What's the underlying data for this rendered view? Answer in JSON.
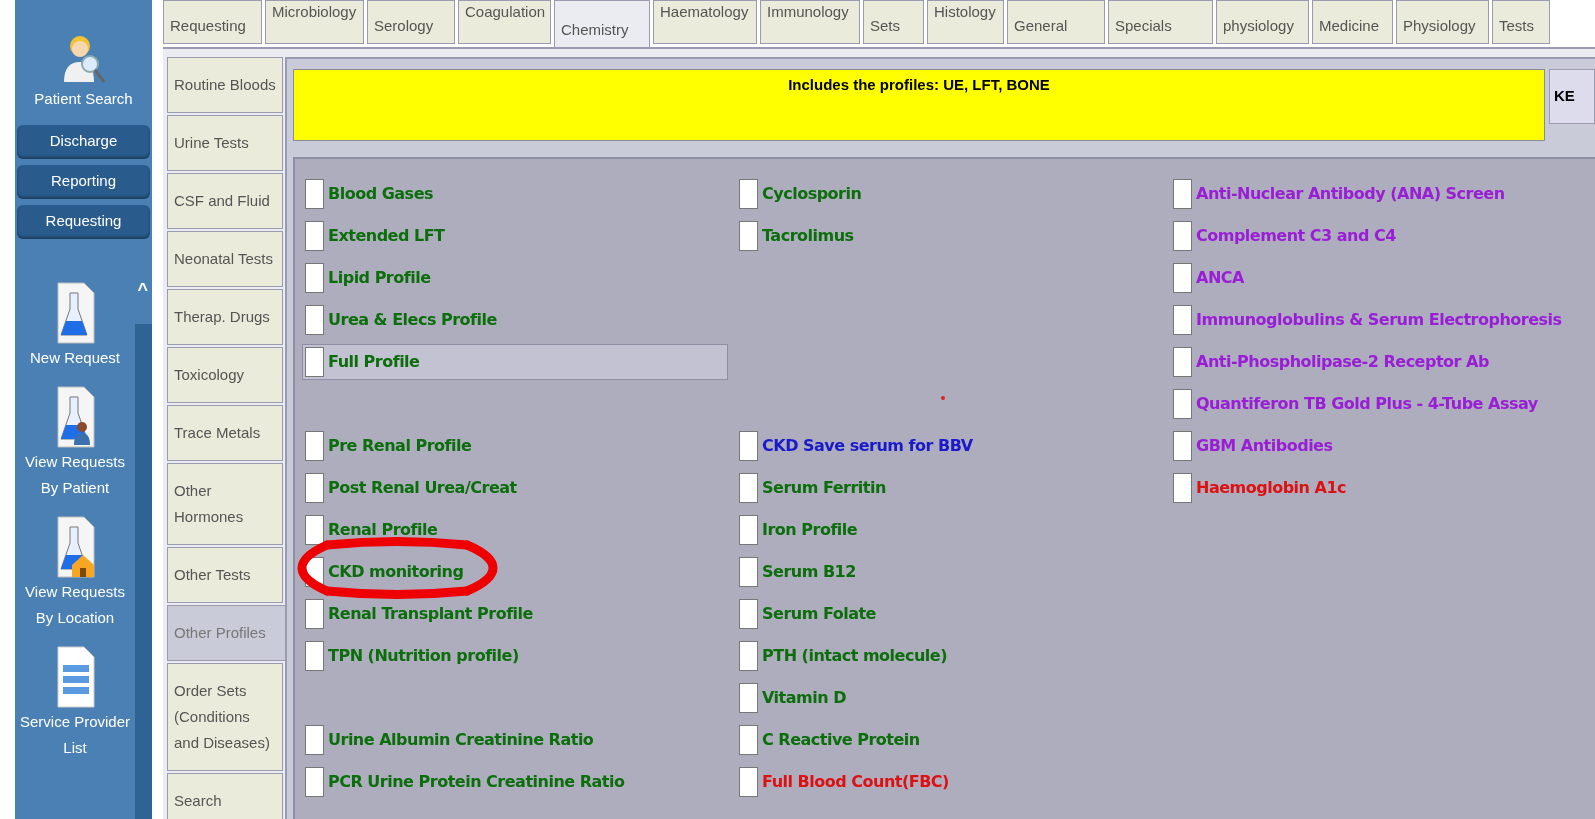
{
  "sidebar": {
    "patient_search": "Patient Search",
    "buttons": [
      "Discharge",
      "Reporting",
      "Requesting"
    ],
    "scroll_up": "^",
    "shortcuts": [
      {
        "kind": "flask",
        "label": "New Request"
      },
      {
        "kind": "flask_person",
        "label": "View Requests By Patient"
      },
      {
        "kind": "flask_house",
        "label": "View Requests By Location"
      },
      {
        "kind": "document",
        "label": "Service Provider List"
      }
    ]
  },
  "top_tabs": [
    {
      "label": "Requesting",
      "kind": "lower",
      "selected": false
    },
    {
      "label": "Microbiology",
      "kind": "upper",
      "selected": false
    },
    {
      "label": "Serology",
      "kind": "lower",
      "selected": false
    },
    {
      "label": "Coagulation",
      "kind": "upper",
      "selected": false
    },
    {
      "label": "Chemistry",
      "kind": "lower",
      "selected": true
    },
    {
      "label": "Haematology",
      "kind": "upper",
      "selected": false
    },
    {
      "label": "Immunology",
      "kind": "upper",
      "selected": false
    },
    {
      "label": "Sets",
      "kind": "lower",
      "selected": false
    },
    {
      "label": "Histology",
      "kind": "upper",
      "selected": false
    },
    {
      "label": "General",
      "kind": "lower",
      "selected": false
    },
    {
      "label": "Specials",
      "kind": "lower",
      "selected": false
    },
    {
      "label": "physiology",
      "kind": "lower",
      "selected": false
    },
    {
      "label": "Medicine",
      "kind": "lower",
      "selected": false
    },
    {
      "label": "Physiology",
      "kind": "lower",
      "selected": false
    },
    {
      "label": "Tests",
      "kind": "lower",
      "selected": false
    }
  ],
  "side_tabs": [
    {
      "label": "Routine Bloods",
      "selected": false
    },
    {
      "label": "Urine Tests",
      "selected": false
    },
    {
      "label": "CSF and Fluid",
      "selected": false
    },
    {
      "label": "Neonatal Tests",
      "selected": false
    },
    {
      "label": "Therap. Drugs",
      "selected": false
    },
    {
      "label": "Toxicology",
      "selected": false
    },
    {
      "label": "Trace Metals",
      "selected": false
    },
    {
      "label": "Other Hormones",
      "selected": false
    },
    {
      "label": "Other Tests",
      "selected": false
    },
    {
      "label": "Other Profiles",
      "selected": true
    },
    {
      "label": "Order Sets (Conditions and Diseases)",
      "selected": false
    },
    {
      "label": "Search",
      "selected": false
    }
  ],
  "banner": "Includes the profiles: UE, LFT, BONE",
  "banner_button": "KE",
  "test_rows": [
    [
      {
        "label": "Blood Gases",
        "color": "#0b6e0b",
        "checked": false,
        "focused": false
      },
      {
        "label": "Cyclosporin",
        "color": "#0b6e0b",
        "checked": false,
        "focused": false
      },
      {
        "label": "Anti-Nuclear Antibody (ANA) Screen",
        "color": "#9a1ed6",
        "checked": false,
        "focused": false
      }
    ],
    [
      {
        "label": "Extended LFT",
        "color": "#0b6e0b",
        "checked": false,
        "focused": false
      },
      {
        "label": "Tacrolimus",
        "color": "#0b6e0b",
        "checked": false,
        "focused": false
      },
      {
        "label": "Complement C3 and C4",
        "color": "#9a1ed6",
        "checked": false,
        "focused": false
      }
    ],
    [
      {
        "label": "Lipid Profile",
        "color": "#0b6e0b",
        "checked": false,
        "focused": false
      },
      null,
      {
        "label": "ANCA",
        "color": "#9a1ed6",
        "checked": false,
        "focused": false
      }
    ],
    [
      {
        "label": "Urea & Elecs Profile",
        "color": "#0b6e0b",
        "checked": false,
        "focused": false
      },
      null,
      {
        "label": "Immunoglobulins & Serum Electrophoresis",
        "color": "#9a1ed6",
        "checked": false,
        "focused": false
      }
    ],
    [
      {
        "label": "Full Profile",
        "color": "#0b6e0b",
        "checked": false,
        "focused": true
      },
      null,
      {
        "label": "Anti-Phospholipase-2 Receptor Ab",
        "color": "#9a1ed6",
        "checked": false,
        "focused": false
      }
    ],
    [
      null,
      null,
      {
        "label": "Quantiferon TB Gold Plus - 4-Tube Assay",
        "color": "#9a1ed6",
        "checked": false,
        "focused": false
      }
    ],
    [
      {
        "label": "Pre Renal Profile",
        "color": "#0b6e0b",
        "checked": false,
        "focused": false
      },
      {
        "label": "CKD Save serum for BBV",
        "color": "#1a1acc",
        "checked": false,
        "focused": false
      },
      {
        "label": "GBM Antibodies",
        "color": "#9a1ed6",
        "checked": false,
        "focused": false
      }
    ],
    [
      {
        "label": "Post Renal Urea/Creat",
        "color": "#0b6e0b",
        "checked": false,
        "focused": false
      },
      {
        "label": "Serum Ferritin",
        "color": "#0b6e0b",
        "checked": false,
        "focused": false
      },
      {
        "label": "Haemoglobin A1c",
        "color": "#dd1111",
        "checked": false,
        "focused": false
      }
    ],
    [
      {
        "label": "Renal Profile",
        "color": "#0b6e0b",
        "checked": false,
        "focused": false
      },
      {
        "label": "Iron Profile",
        "color": "#0b6e0b",
        "checked": false,
        "focused": false
      },
      null
    ],
    [
      {
        "label": "CKD monitoring",
        "color": "#0b6e0b",
        "checked": false,
        "focused": false
      },
      {
        "label": "Serum B12",
        "color": "#0b6e0b",
        "checked": false,
        "focused": false
      },
      null
    ],
    [
      {
        "label": "Renal Transplant Profile",
        "color": "#0b6e0b",
        "checked": false,
        "focused": false
      },
      {
        "label": "Serum Folate",
        "color": "#0b6e0b",
        "checked": false,
        "focused": false
      },
      null
    ],
    [
      {
        "label": "TPN (Nutrition profile)",
        "color": "#0b6e0b",
        "checked": false,
        "focused": false
      },
      {
        "label": "PTH (intact molecule)",
        "color": "#0b6e0b",
        "checked": false,
        "focused": false
      },
      null
    ],
    [
      null,
      {
        "label": "Vitamin D",
        "color": "#0b6e0b",
        "checked": false,
        "focused": false
      },
      null
    ],
    [
      {
        "label": "Urine Albumin Creatinine Ratio",
        "color": "#0b6e0b",
        "checked": false,
        "focused": false
      },
      {
        "label": "C Reactive Protein",
        "color": "#0b6e0b",
        "checked": false,
        "focused": false
      },
      null
    ],
    [
      {
        "label": "PCR Urine Protein Creatinine Ratio",
        "color": "#0b6e0b",
        "checked": false,
        "focused": false
      },
      {
        "label": "Full Blood Count(FBC)",
        "color": "#dd1111",
        "checked": false,
        "focused": false
      },
      null
    ]
  ]
}
